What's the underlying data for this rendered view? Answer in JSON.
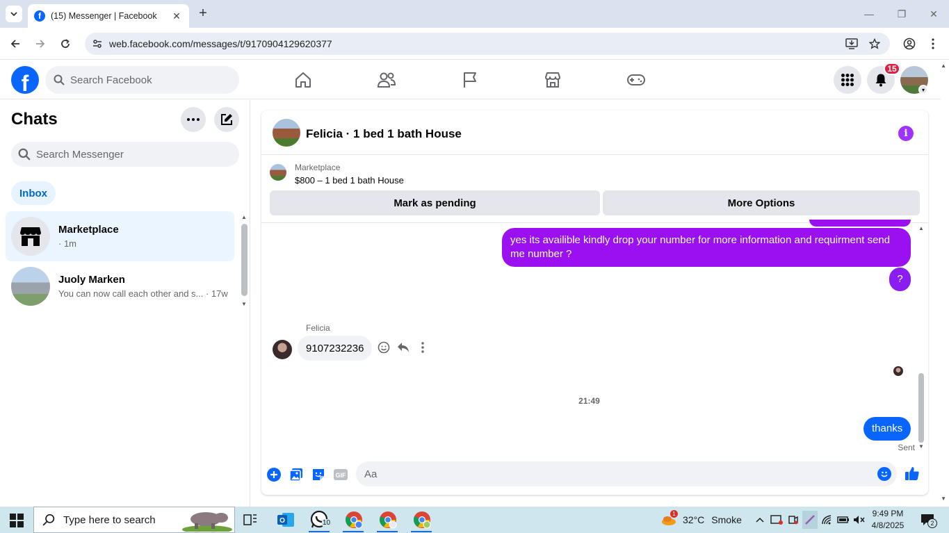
{
  "browser": {
    "tab_title": "(15) Messenger | Facebook",
    "url": "web.facebook.com/messages/t/9170904129620377"
  },
  "header": {
    "search_placeholder": "Search Facebook",
    "notification_count": "15",
    "nav": [
      "home",
      "friends",
      "pages",
      "marketplace",
      "gaming"
    ]
  },
  "sidebar": {
    "title": "Chats",
    "search_placeholder": "Search Messenger",
    "filter_label": "Inbox",
    "conversations": [
      {
        "name": "Marketplace",
        "subtitle": "· 1m",
        "active": true
      },
      {
        "name": "Juoly Marken",
        "subtitle": "You can now call each other and s... · 17w",
        "active": false
      }
    ]
  },
  "chat": {
    "title": "Felicia · 1 bed 1 bath House",
    "marketplace": {
      "label": "Marketplace",
      "listing": "$800 – 1 bed 1 bath House",
      "pending_button": "Mark as pending",
      "options_button": "More Options"
    },
    "messages": {
      "outgoing_1": "yes its availible kindly drop your number for more information and requirment send me number ?",
      "outgoing_2": "?",
      "sender_name": "Felicia",
      "incoming_1": "9107232236",
      "timestamp": "21:49",
      "outgoing_3": "thanks",
      "status": "Sent"
    },
    "composer_placeholder": "Aa"
  },
  "taskbar": {
    "search_placeholder": "Type here to search",
    "whatsapp_count": "10",
    "weather_badge": "1",
    "temperature": "32°C",
    "condition": "Smoke",
    "time": "9:49 PM",
    "date": "4/8/2025",
    "notification_count": "2"
  },
  "colors": {
    "facebook_blue": "#0866ff",
    "messenger_purple": "#9a10f0",
    "badge_red": "#e41e3f",
    "active_chat_bg": "#ebf5ff"
  }
}
